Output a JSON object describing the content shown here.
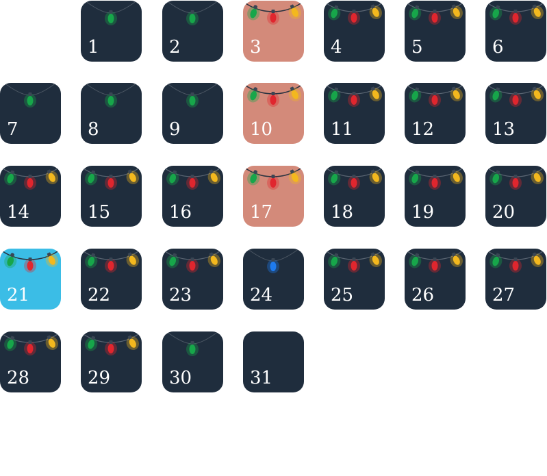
{
  "calendar": {
    "colors": {
      "tile_default": "#1f2d3d",
      "tile_pink": "#d38a7a",
      "tile_blue": "#3bbde6",
      "bulb_green": "#17a64a",
      "bulb_red": "#e0262e",
      "bulb_yellow": "#f3b81e",
      "bulb_blue": "#1e7bf0"
    },
    "days": [
      {
        "label": "1",
        "lights": "green"
      },
      {
        "label": "2",
        "lights": "green"
      },
      {
        "label": "3",
        "lights": "three",
        "bg": "pink"
      },
      {
        "label": "4",
        "lights": "three"
      },
      {
        "label": "5",
        "lights": "three"
      },
      {
        "label": "6",
        "lights": "three"
      },
      {
        "label": "7",
        "lights": "green"
      },
      {
        "label": "8",
        "lights": "green"
      },
      {
        "label": "9",
        "lights": "green"
      },
      {
        "label": "10",
        "lights": "three",
        "bg": "pink"
      },
      {
        "label": "11",
        "lights": "three"
      },
      {
        "label": "12",
        "lights": "three"
      },
      {
        "label": "13",
        "lights": "three"
      },
      {
        "label": "14",
        "lights": "three"
      },
      {
        "label": "15",
        "lights": "three"
      },
      {
        "label": "16",
        "lights": "three"
      },
      {
        "label": "17",
        "lights": "three",
        "bg": "pink"
      },
      {
        "label": "18",
        "lights": "three"
      },
      {
        "label": "19",
        "lights": "three"
      },
      {
        "label": "20",
        "lights": "three"
      },
      {
        "label": "21",
        "lights": "three",
        "bg": "blue"
      },
      {
        "label": "22",
        "lights": "three"
      },
      {
        "label": "23",
        "lights": "three"
      },
      {
        "label": "24",
        "lights": "blue"
      },
      {
        "label": "25",
        "lights": "three"
      },
      {
        "label": "26",
        "lights": "three"
      },
      {
        "label": "27",
        "lights": "three"
      },
      {
        "label": "28",
        "lights": "three"
      },
      {
        "label": "29",
        "lights": "three"
      },
      {
        "label": "30",
        "lights": "green"
      },
      {
        "label": "31",
        "lights": "none"
      }
    ]
  }
}
